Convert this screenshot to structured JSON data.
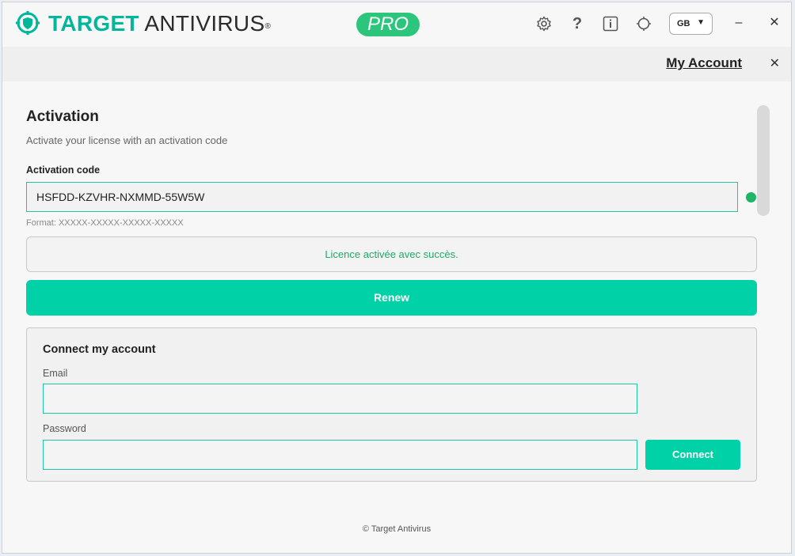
{
  "titlebar": {
    "brand_primary": "TARGET",
    "brand_secondary": "ANTIVIRUS",
    "trademark": "®",
    "edition_badge": "PRO",
    "language": "GB",
    "icons": [
      "settings-gear-icon",
      "help-icon",
      "info-icon",
      "theme-icon"
    ],
    "minimize": "–",
    "close": "✕"
  },
  "subbar": {
    "title": "My Account",
    "close": "✕"
  },
  "activation": {
    "heading": "Activation",
    "subtitle": "Activate your license with an activation code",
    "code_label": "Activation code",
    "code_value": "HSFDD-KZVHR-NXMMD-55W5W",
    "format_hint": "Format: XXXXX-XXXXX-XXXXX-XXXXX",
    "status_message": "Licence activée avec succès.",
    "renew_label": "Renew"
  },
  "connect": {
    "title": "Connect my account",
    "email_label": "Email",
    "email_value": "",
    "password_label": "Password",
    "password_value": "",
    "button_label": "Connect"
  },
  "footer": {
    "copyright": "© Target Antivirus"
  },
  "colors": {
    "accent": "#00d1a6",
    "brand_teal": "#00b79c",
    "pro_badge": "#2cc57c",
    "success_text": "#1ea86a",
    "status_dot": "#1fb566"
  }
}
